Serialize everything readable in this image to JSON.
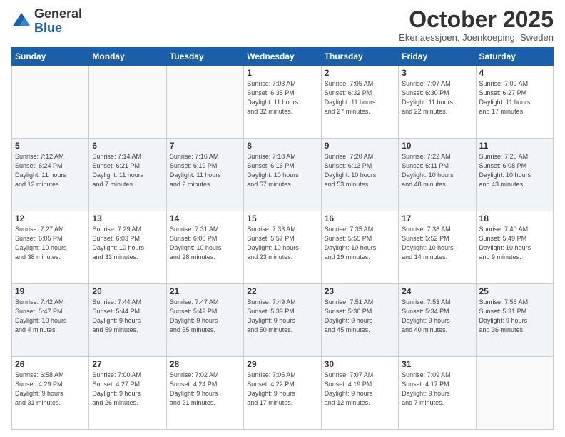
{
  "header": {
    "logo_general": "General",
    "logo_blue": "Blue",
    "month": "October 2025",
    "location": "Ekenaessjoen, Joenkoeping, Sweden"
  },
  "weekdays": [
    "Sunday",
    "Monday",
    "Tuesday",
    "Wednesday",
    "Thursday",
    "Friday",
    "Saturday"
  ],
  "weeks": [
    [
      {
        "day": "",
        "info": ""
      },
      {
        "day": "",
        "info": ""
      },
      {
        "day": "",
        "info": ""
      },
      {
        "day": "1",
        "info": "Sunrise: 7:03 AM\nSunset: 6:35 PM\nDaylight: 11 hours\nand 32 minutes."
      },
      {
        "day": "2",
        "info": "Sunrise: 7:05 AM\nSunset: 6:32 PM\nDaylight: 11 hours\nand 27 minutes."
      },
      {
        "day": "3",
        "info": "Sunrise: 7:07 AM\nSunset: 6:30 PM\nDaylight: 11 hours\nand 22 minutes."
      },
      {
        "day": "4",
        "info": "Sunrise: 7:09 AM\nSunset: 6:27 PM\nDaylight: 11 hours\nand 17 minutes."
      }
    ],
    [
      {
        "day": "5",
        "info": "Sunrise: 7:12 AM\nSunset: 6:24 PM\nDaylight: 11 hours\nand 12 minutes."
      },
      {
        "day": "6",
        "info": "Sunrise: 7:14 AM\nSunset: 6:21 PM\nDaylight: 11 hours\nand 7 minutes."
      },
      {
        "day": "7",
        "info": "Sunrise: 7:16 AM\nSunset: 6:19 PM\nDaylight: 11 hours\nand 2 minutes."
      },
      {
        "day": "8",
        "info": "Sunrise: 7:18 AM\nSunset: 6:16 PM\nDaylight: 10 hours\nand 57 minutes."
      },
      {
        "day": "9",
        "info": "Sunrise: 7:20 AM\nSunset: 6:13 PM\nDaylight: 10 hours\nand 53 minutes."
      },
      {
        "day": "10",
        "info": "Sunrise: 7:22 AM\nSunset: 6:11 PM\nDaylight: 10 hours\nand 48 minutes."
      },
      {
        "day": "11",
        "info": "Sunrise: 7:25 AM\nSunset: 6:08 PM\nDaylight: 10 hours\nand 43 minutes."
      }
    ],
    [
      {
        "day": "12",
        "info": "Sunrise: 7:27 AM\nSunset: 6:05 PM\nDaylight: 10 hours\nand 38 minutes."
      },
      {
        "day": "13",
        "info": "Sunrise: 7:29 AM\nSunset: 6:03 PM\nDaylight: 10 hours\nand 33 minutes."
      },
      {
        "day": "14",
        "info": "Sunrise: 7:31 AM\nSunset: 6:00 PM\nDaylight: 10 hours\nand 28 minutes."
      },
      {
        "day": "15",
        "info": "Sunrise: 7:33 AM\nSunset: 5:57 PM\nDaylight: 10 hours\nand 23 minutes."
      },
      {
        "day": "16",
        "info": "Sunrise: 7:35 AM\nSunset: 5:55 PM\nDaylight: 10 hours\nand 19 minutes."
      },
      {
        "day": "17",
        "info": "Sunrise: 7:38 AM\nSunset: 5:52 PM\nDaylight: 10 hours\nand 14 minutes."
      },
      {
        "day": "18",
        "info": "Sunrise: 7:40 AM\nSunset: 5:49 PM\nDaylight: 10 hours\nand 9 minutes."
      }
    ],
    [
      {
        "day": "19",
        "info": "Sunrise: 7:42 AM\nSunset: 5:47 PM\nDaylight: 10 hours\nand 4 minutes."
      },
      {
        "day": "20",
        "info": "Sunrise: 7:44 AM\nSunset: 5:44 PM\nDaylight: 9 hours\nand 59 minutes."
      },
      {
        "day": "21",
        "info": "Sunrise: 7:47 AM\nSunset: 5:42 PM\nDaylight: 9 hours\nand 55 minutes."
      },
      {
        "day": "22",
        "info": "Sunrise: 7:49 AM\nSunset: 5:39 PM\nDaylight: 9 hours\nand 50 minutes."
      },
      {
        "day": "23",
        "info": "Sunrise: 7:51 AM\nSunset: 5:36 PM\nDaylight: 9 hours\nand 45 minutes."
      },
      {
        "day": "24",
        "info": "Sunrise: 7:53 AM\nSunset: 5:34 PM\nDaylight: 9 hours\nand 40 minutes."
      },
      {
        "day": "25",
        "info": "Sunrise: 7:55 AM\nSunset: 5:31 PM\nDaylight: 9 hours\nand 36 minutes."
      }
    ],
    [
      {
        "day": "26",
        "info": "Sunrise: 6:58 AM\nSunset: 4:29 PM\nDaylight: 9 hours\nand 31 minutes."
      },
      {
        "day": "27",
        "info": "Sunrise: 7:00 AM\nSunset: 4:27 PM\nDaylight: 9 hours\nand 26 minutes."
      },
      {
        "day": "28",
        "info": "Sunrise: 7:02 AM\nSunset: 4:24 PM\nDaylight: 9 hours\nand 21 minutes."
      },
      {
        "day": "29",
        "info": "Sunrise: 7:05 AM\nSunset: 4:22 PM\nDaylight: 9 hours\nand 17 minutes."
      },
      {
        "day": "30",
        "info": "Sunrise: 7:07 AM\nSunset: 4:19 PM\nDaylight: 9 hours\nand 12 minutes."
      },
      {
        "day": "31",
        "info": "Sunrise: 7:09 AM\nSunset: 4:17 PM\nDaylight: 9 hours\nand 7 minutes."
      },
      {
        "day": "",
        "info": ""
      }
    ]
  ]
}
